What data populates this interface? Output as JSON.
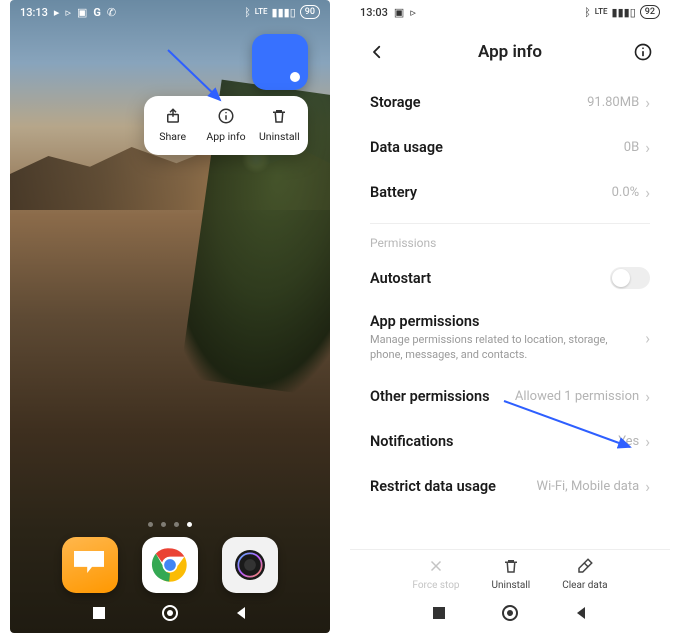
{
  "left": {
    "status": {
      "time": "13:13",
      "battery": "90"
    },
    "popup": {
      "share": "Share",
      "app_info": "App info",
      "uninstall": "Uninstall"
    }
  },
  "right": {
    "status": {
      "time": "13:03",
      "battery": "92"
    },
    "header": {
      "title": "App info"
    },
    "rows": {
      "storage_label": "Storage",
      "storage_value": "91.80MB",
      "datausage_label": "Data usage",
      "datausage_value": "0B",
      "battery_label": "Battery",
      "battery_value": "0.0%",
      "permissions_header": "Permissions",
      "autostart_label": "Autostart",
      "appperm_label": "App permissions",
      "appperm_desc": "Manage permissions related to location, storage, phone, messages, and contacts.",
      "otherperm_label": "Other permissions",
      "otherperm_value": "Allowed 1 permission",
      "notif_label": "Notifications",
      "notif_value": "Yes",
      "restrict_label": "Restrict data usage",
      "restrict_value": "Wi-Fi, Mobile data"
    },
    "actions": {
      "forcestop": "Force stop",
      "uninstall": "Uninstall",
      "cleardata": "Clear data"
    }
  }
}
